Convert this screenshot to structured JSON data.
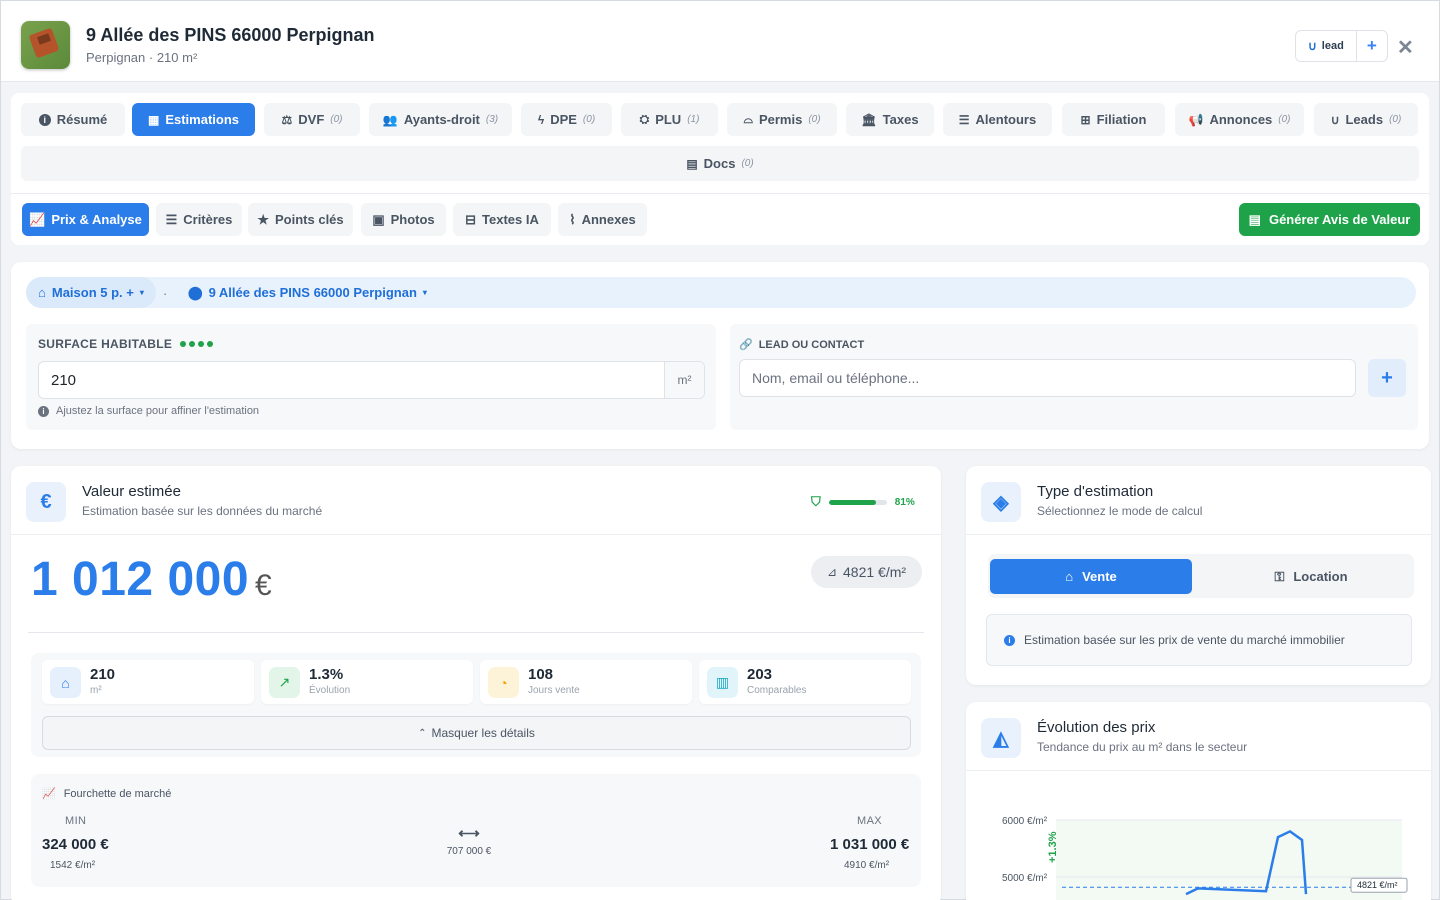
{
  "header": {
    "title": "9 Allée des PINS 66000 Perpignan",
    "subtitle": "Perpignan · 210 m²",
    "lead_label": "lead",
    "plus": "+",
    "close": "✕"
  },
  "tabs": [
    {
      "label": "Résumé",
      "count": "",
      "icon": "info-icon"
    },
    {
      "label": "Estimations",
      "count": "",
      "icon": "calculator-icon"
    },
    {
      "label": "DVF",
      "count": "(0)",
      "icon": "balance-icon"
    },
    {
      "label": "Ayants-droit",
      "count": "(3)",
      "icon": "users-icon"
    },
    {
      "label": "DPE",
      "count": "(0)",
      "icon": "bolt-icon"
    },
    {
      "label": "PLU",
      "count": "(1)",
      "icon": "map-icon"
    },
    {
      "label": "Permis",
      "count": "(0)",
      "icon": "helmet-icon"
    },
    {
      "label": "Taxes",
      "count": "",
      "icon": "landmark-icon"
    },
    {
      "label": "Alentours",
      "count": "",
      "icon": "signs-icon"
    },
    {
      "label": "Filiation",
      "count": "",
      "icon": "sitemap-icon"
    },
    {
      "label": "Annonces",
      "count": "(0)",
      "icon": "megaphone-icon"
    },
    {
      "label": "Leads",
      "count": "(0)",
      "icon": "magnet-icon"
    }
  ],
  "docs_tab": {
    "label": "Docs",
    "count": "(0)"
  },
  "subtabs": [
    {
      "label": "Prix & Analyse"
    },
    {
      "label": "Critères"
    },
    {
      "label": "Points clés"
    },
    {
      "label": "Photos"
    },
    {
      "label": "Textes IA"
    },
    {
      "label": "Annexes"
    }
  ],
  "generate_button": "Générer Avis de Valeur",
  "chips": {
    "property": "Maison 5 p. +",
    "address": "9 Allée des PINS 66000 Perpignan",
    "separator": "·"
  },
  "surface": {
    "label": "SURFACE HABITABLE",
    "value": "210",
    "unit": "m²",
    "hint": "Ajustez la surface pour affiner l'estimation"
  },
  "lead_contact": {
    "label": "LEAD OU CONTACT",
    "placeholder": "Nom, email ou téléphone...",
    "add": "+"
  },
  "valuation": {
    "title": "Valeur estimée",
    "subtitle": "Estimation basée sur les données du marché",
    "confidence_label": "81%",
    "confidence_fraction": 0.81,
    "value": "1 012 000",
    "currency": "€",
    "price_per_m2": "4821  €/m²"
  },
  "stats": [
    {
      "value": "210",
      "label": "m²",
      "icon": "home-icon",
      "color": "#2b7de9",
      "bg": "#e6effc"
    },
    {
      "value": "1.3%",
      "label": "Évolution",
      "icon": "chart-line-icon",
      "color": "#1fa34a",
      "bg": "#e2f5e8"
    },
    {
      "value": "108",
      "label": "Jours vente",
      "icon": "clock-icon",
      "color": "#f0a500",
      "bg": "#fdf3d9"
    },
    {
      "value": "203",
      "label": "Comparables",
      "icon": "building-icon",
      "color": "#1aa7c7",
      "bg": "#e0f4f9"
    }
  ],
  "details_toggle": "Masquer les détails",
  "range": {
    "title": "Fourchette de marché",
    "min_label": "MIN",
    "min_value": "324 000 €",
    "min_ppm": "1542 €/m²",
    "spread": "707 000 €",
    "max_label": "MAX",
    "max_value": "1 031 000 €",
    "max_ppm": "4910 €/m²"
  },
  "estimation_type": {
    "title": "Type d'estimation",
    "subtitle": "Sélectionnez le mode de calcul",
    "sale": "Vente",
    "rent": "Location",
    "info": "Estimation basée sur les prix de vente du marché immobilier"
  },
  "price_evolution": {
    "title": "Évolution des prix",
    "subtitle": "Tendance du prix au m² dans le secteur"
  },
  "chart_data": {
    "type": "line",
    "y_ticks": [
      "6000 €/m²",
      "5000 €/m²"
    ],
    "trend_label": "+1.3%",
    "reference_label": "4821 €/m²",
    "reference_value": 4821,
    "ylim": [
      4600,
      6000
    ],
    "series": [
      {
        "values": [
          4700,
          4800,
          4750,
          5700,
          5800,
          5650,
          4700
        ]
      }
    ],
    "colors": {
      "line": "#2b7de9",
      "trend": "#1fa34a"
    }
  }
}
